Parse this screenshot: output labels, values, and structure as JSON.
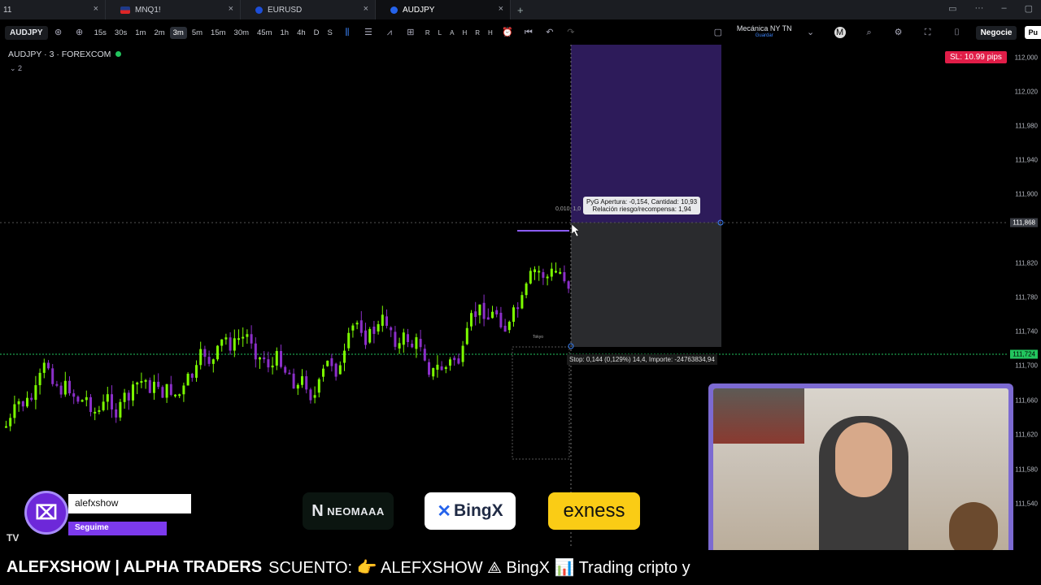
{
  "tabs": [
    {
      "label": "11",
      "close": "×"
    },
    {
      "label": "MNQ1!",
      "close": "×"
    },
    {
      "label": "EURUSD",
      "close": "×"
    },
    {
      "label": "AUDJPY",
      "close": "×"
    }
  ],
  "new_tab": "+",
  "toolbar": {
    "symbol": "AUDJPY",
    "timeframes": [
      "15s",
      "30s",
      "1m",
      "2m",
      "3m",
      "5m",
      "15m",
      "30m",
      "45m",
      "1h",
      "4h",
      "D",
      "S"
    ],
    "selected_timeframe": "3m",
    "replay_letters": [
      "R",
      "L",
      "A",
      "H",
      "R",
      "H"
    ],
    "strategy": "Mecánica NY TN",
    "strategy_sub": "Guardar",
    "trade_button": "Negocie",
    "publish_button": "Pu"
  },
  "chart": {
    "title": "AUDJPY · 3 · FOREXCOM",
    "indicator_count": "2",
    "sl_badge": "SL: 10.99 pips",
    "tooltip_line1": "PyG Apertura: -0,154, Cantidad: 10,93",
    "tooltip_line2": "Relación riesgo/recompensa: 1,94",
    "stop_label": "Stop: 0,144 (0,129%) 14,4, Importe: -2476383​4,94",
    "qty_label": "0,010, 1,0",
    "mini_label": "Tokyo",
    "price_ticks": [
      "112,000",
      "112,020",
      "111,980",
      "111,940",
      "111,900",
      "111,868",
      "111,820",
      "111,780",
      "111,740",
      "111,724",
      "111,700",
      "111,660",
      "111,620",
      "111,580",
      "111,540"
    ],
    "current_price": "111,868",
    "stop_price": "111,724"
  },
  "overlay": {
    "twitch_user": "alefxshow",
    "twitch_follow": "Seguime",
    "sponsor1": "NEOMAAA",
    "sponsor2": "BingX",
    "sponsor3": "exness"
  },
  "ticker": {
    "brand": "ALEFXSHOW | ALPHA TRADERS",
    "text": "SCUENTO: 👉 ALEFXSHOW   ⟁  BingX 📊 Trading cripto y"
  },
  "colors": {
    "up": "#7cfc00",
    "down": "#8b2fc9",
    "target_zone": "#2d1b5a",
    "stop_zone": "#2a2b2e",
    "sl_badge": "#e11d48"
  }
}
